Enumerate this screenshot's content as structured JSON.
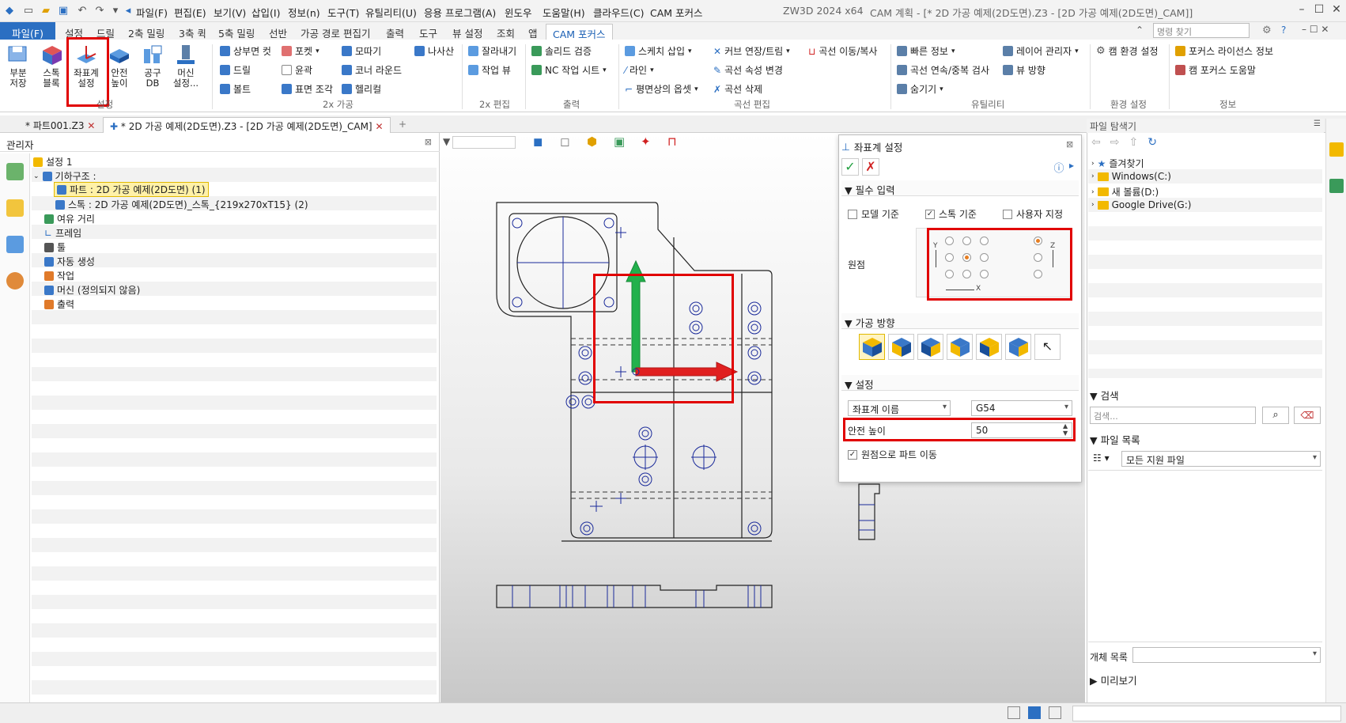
{
  "titlebar": {
    "menus": [
      "파일(F)",
      "편집(E)",
      "보기(V)",
      "삽입(I)",
      "정보(n)",
      "도구(T)",
      "유틸리티(U)",
      "응용 프로그램(A)",
      "윈도우",
      "도움말(H)",
      "클라우드(C)",
      "CAM 포커스"
    ],
    "app_title": "ZW3D 2024 x64",
    "doc_title": "CAM 계획 - [* 2D 가공 예제(2D도면).Z3 - [2D 가공 예제(2D도면)_CAM]]"
  },
  "ribbon_tabs": [
    "파일(F)",
    "설정",
    "드릴",
    "2축 밀링",
    "3축 퀵",
    "5축 밀링",
    "선반",
    "가공 경로 편집기",
    "출력",
    "도구",
    "뷰 설정",
    "조회",
    "앱",
    "CAM 포커스"
  ],
  "command_search": {
    "placeholder": "명령 찾기"
  },
  "ribbon": {
    "setup_buttons": [
      {
        "label": "부분 저장",
        "icon": "save-part-icon"
      },
      {
        "label": "스톡 블록",
        "icon": "stock-block-icon"
      },
      {
        "label": "좌표계 설정",
        "icon": "coordinate-system-icon"
      },
      {
        "label": "안전 높이",
        "icon": "safe-height-icon"
      },
      {
        "label": "공구 DB",
        "icon": "tool-db-icon"
      },
      {
        "label": "머신 설정...",
        "icon": "machine-setup-icon"
      }
    ],
    "group_setup": "설정",
    "machining_col1": [
      "상부면 컷",
      "드릴",
      "볼트"
    ],
    "machining_col2": [
      "포켓",
      "윤곽",
      "표면 조각"
    ],
    "machining_col3": [
      "모따기",
      "코너 라운드",
      "헬리컬"
    ],
    "machining_col4": [
      "나사산"
    ],
    "group_2x": "2x 가공",
    "edit2x": [
      "잘라내기",
      "작업 뷰"
    ],
    "group_2x_edit": "2x 편집",
    "output": [
      "솔리드 검증",
      "NC 작업 시트"
    ],
    "group_output": "출력",
    "curve_col1": [
      "스케치 삽입",
      "라인",
      "평면상의 옵셋"
    ],
    "curve_col2": [
      "커브 연장/트림",
      "곡선 속성 변경",
      "곡선 삭제"
    ],
    "curve_col3": [
      "곡선 이동/복사"
    ],
    "group_curve": "곡선 편집",
    "util_col1": [
      "빠른 정보",
      "곡선 연속/중복 검사",
      "숨기기"
    ],
    "util_col2": [
      "레이어 관리자",
      "뷰 방향"
    ],
    "group_util": "유틸리티",
    "env": [
      "캠 환경 설정"
    ],
    "group_env": "환경 설정",
    "info": [
      "포커스 라이선스 정보",
      "캠 포커스 도움말"
    ],
    "group_info": "정보"
  },
  "doc_tabs": [
    "* 파트001.Z3",
    "* 2D 가공 예제(2D도면).Z3 - [2D 가공 예제(2D도면)_CAM]"
  ],
  "manager": {
    "title": "관리자",
    "tree": [
      {
        "label": "설정 1",
        "level": 0
      },
      {
        "label": "기하구조 :",
        "level": 1
      },
      {
        "label": "파트 : 2D 가공 예제(2D도면) (1)",
        "level": 2
      },
      {
        "label": "스톡 : 2D 가공 예제(2D도면)_스톡_{219x270xT15} (2)",
        "level": 2
      },
      {
        "label": "여유 거리",
        "level": 1
      },
      {
        "label": "프레임",
        "level": 1
      },
      {
        "label": "툴",
        "level": 1
      },
      {
        "label": "자동 생성",
        "level": 1
      },
      {
        "label": "작업",
        "level": 1
      },
      {
        "label": "머신 (정의되지 않음)",
        "level": 1
      },
      {
        "label": "출력",
        "level": 1
      }
    ]
  },
  "dialog": {
    "title": "좌표계 설정",
    "section_required": "필수 입력",
    "check_model": "모델 기준",
    "check_stock": "스톡 기준",
    "check_user": "사용자 지정",
    "origin_label": "원점",
    "axis_y": "Y",
    "axis_x": "X",
    "axis_z": "Z",
    "section_direction": "가공 방향",
    "section_settings": "설정",
    "cs_name_label": "좌표계 이름",
    "cs_name_value": "G54",
    "safe_height_label": "안전 높이",
    "safe_height_value": "50",
    "move_part_label": "원점으로 파트 이동"
  },
  "explorer": {
    "title": "파일 탐색기",
    "items": [
      "즐겨찾기",
      "Windows(C:)",
      "새 볼륨(D:)",
      "Google Drive(G:)"
    ],
    "search_section": "검색",
    "search_placeholder": "검색...",
    "file_list_section": "파일 목록",
    "file_filter": "모든 지원 파일",
    "object_list_label": "개체 목록",
    "preview_section": "미리보기"
  },
  "colors": {
    "accent": "#2b6fc2",
    "highlight": "#e10000",
    "axis_x": "#e02020",
    "axis_y": "#22b14c"
  }
}
